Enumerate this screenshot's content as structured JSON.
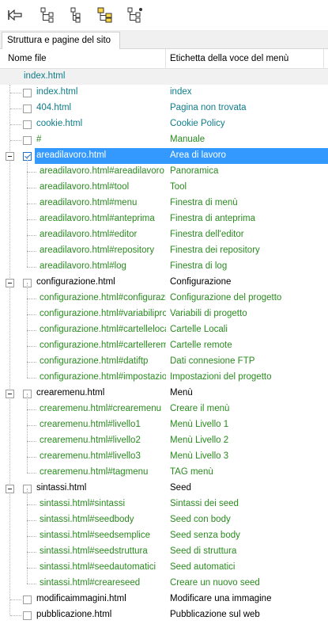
{
  "toolbar": {
    "buttons": [
      {
        "name": "back-icon"
      },
      {
        "name": "expand-tree-icon"
      },
      {
        "name": "collapse-tree-icon"
      },
      {
        "name": "folder-tree-icon"
      },
      {
        "name": "tree-branch-icon"
      }
    ]
  },
  "tab": {
    "label": "Struttura e pagine del sito"
  },
  "columns": {
    "file": "Nome file",
    "label": "Etichetta della voce del menù"
  },
  "root": {
    "file": "index.html"
  },
  "colors": {
    "teal": "#0f7d8a",
    "green": "#2a8a20",
    "selection": "#3399ff"
  },
  "rows": [
    {
      "file": "index.html",
      "label": "index",
      "style": "teal",
      "level": 0,
      "checked": false
    },
    {
      "file": "404.html",
      "label": "Pagina non trovata",
      "style": "teal",
      "level": 0,
      "checked": false
    },
    {
      "file": "cookie.html",
      "label": "Cookie Policy",
      "style": "teal",
      "level": 0,
      "checked": false
    },
    {
      "file": "#",
      "label": "Manuale",
      "style": "green",
      "level": 0,
      "checked": false
    },
    {
      "file": "areadilavoro.html",
      "label": "Area di lavoro",
      "style": "black",
      "level": 0,
      "checked": true,
      "selected": true,
      "toggle": true
    },
    {
      "file": "areadilavoro.html#areadilavoro",
      "label": "Panoramica",
      "style": "green",
      "level": 1
    },
    {
      "file": "areadilavoro.html#tool",
      "label": "Tool",
      "style": "green",
      "level": 1
    },
    {
      "file": "areadilavoro.html#menu",
      "label": "Finestra di menù",
      "style": "green",
      "level": 1
    },
    {
      "file": "areadilavoro.html#anteprima",
      "label": "Finestra di anteprima",
      "style": "green",
      "level": 1
    },
    {
      "file": "areadilavoro.html#editor",
      "label": "Finestra dell'editor",
      "style": "green",
      "level": 1
    },
    {
      "file": "areadilavoro.html#repository",
      "label": "Finestra dei repository",
      "style": "green",
      "level": 1
    },
    {
      "file": "areadilavoro.html#log",
      "label": "Finestra di log",
      "style": "green",
      "level": 1
    },
    {
      "file": "configurazione.html",
      "label": "Configurazione",
      "style": "black",
      "level": 0,
      "checked": false,
      "toggle": true
    },
    {
      "file": "configurazione.html#configurazio",
      "label": "Configurazione del progetto",
      "style": "green",
      "level": 1
    },
    {
      "file": "configurazione.html#variabiliprog",
      "label": "Variabili di progetto",
      "style": "green",
      "level": 1
    },
    {
      "file": "configurazione.html#cartellelocal",
      "label": "Cartelle Locali",
      "style": "green",
      "level": 1
    },
    {
      "file": "configurazione.html#cartelleremc",
      "label": "Cartelle remote",
      "style": "green",
      "level": 1
    },
    {
      "file": "configurazione.html#datiftp",
      "label": "Dati connesione FTP",
      "style": "green",
      "level": 1
    },
    {
      "file": "configurazione.html#impostazion",
      "label": "Impostazioni del progetto",
      "style": "green",
      "level": 1
    },
    {
      "file": "crearemenu.html",
      "label": "Menù",
      "style": "black",
      "level": 0,
      "checked": false,
      "toggle": true
    },
    {
      "file": "crearemenu.html#crearemenu",
      "label": "Creare il menù",
      "style": "green",
      "level": 1
    },
    {
      "file": "crearemenu.html#livello1",
      "label": "Menù Livello 1",
      "style": "green",
      "level": 1
    },
    {
      "file": "crearemenu.html#livello2",
      "label": "Menù Livello 2",
      "style": "green",
      "level": 1
    },
    {
      "file": "crearemenu.html#livello3",
      "label": "Menù Livello 3",
      "style": "green",
      "level": 1
    },
    {
      "file": "crearemenu.html#tagmenu",
      "label": "TAG menù",
      "style": "green",
      "level": 1
    },
    {
      "file": "sintassi.html",
      "label": "Seed",
      "style": "black",
      "level": 0,
      "checked": false,
      "toggle": true
    },
    {
      "file": "sintassi.html#sintassi",
      "label": "Sintassi dei seed",
      "style": "green",
      "level": 1
    },
    {
      "file": "sintassi.html#seedbody",
      "label": "Seed con body",
      "style": "green",
      "level": 1
    },
    {
      "file": "sintassi.html#seedsemplice",
      "label": "Seed senza body",
      "style": "green",
      "level": 1
    },
    {
      "file": "sintassi.html#seedstruttura",
      "label": "Seed di struttura",
      "style": "green",
      "level": 1
    },
    {
      "file": "sintassi.html#seedautomatici",
      "label": "Seed automatici",
      "style": "green",
      "level": 1
    },
    {
      "file": "sintassi.html#creareseed",
      "label": "Creare un nuovo seed",
      "style": "green",
      "level": 1
    },
    {
      "file": "modificaimmagini.html",
      "label": "Modificare una immagine",
      "style": "black",
      "level": 0,
      "checked": false
    },
    {
      "file": "pubblicazione.html",
      "label": "Pubblicazione sul web",
      "style": "black",
      "level": 0,
      "checked": false
    }
  ]
}
